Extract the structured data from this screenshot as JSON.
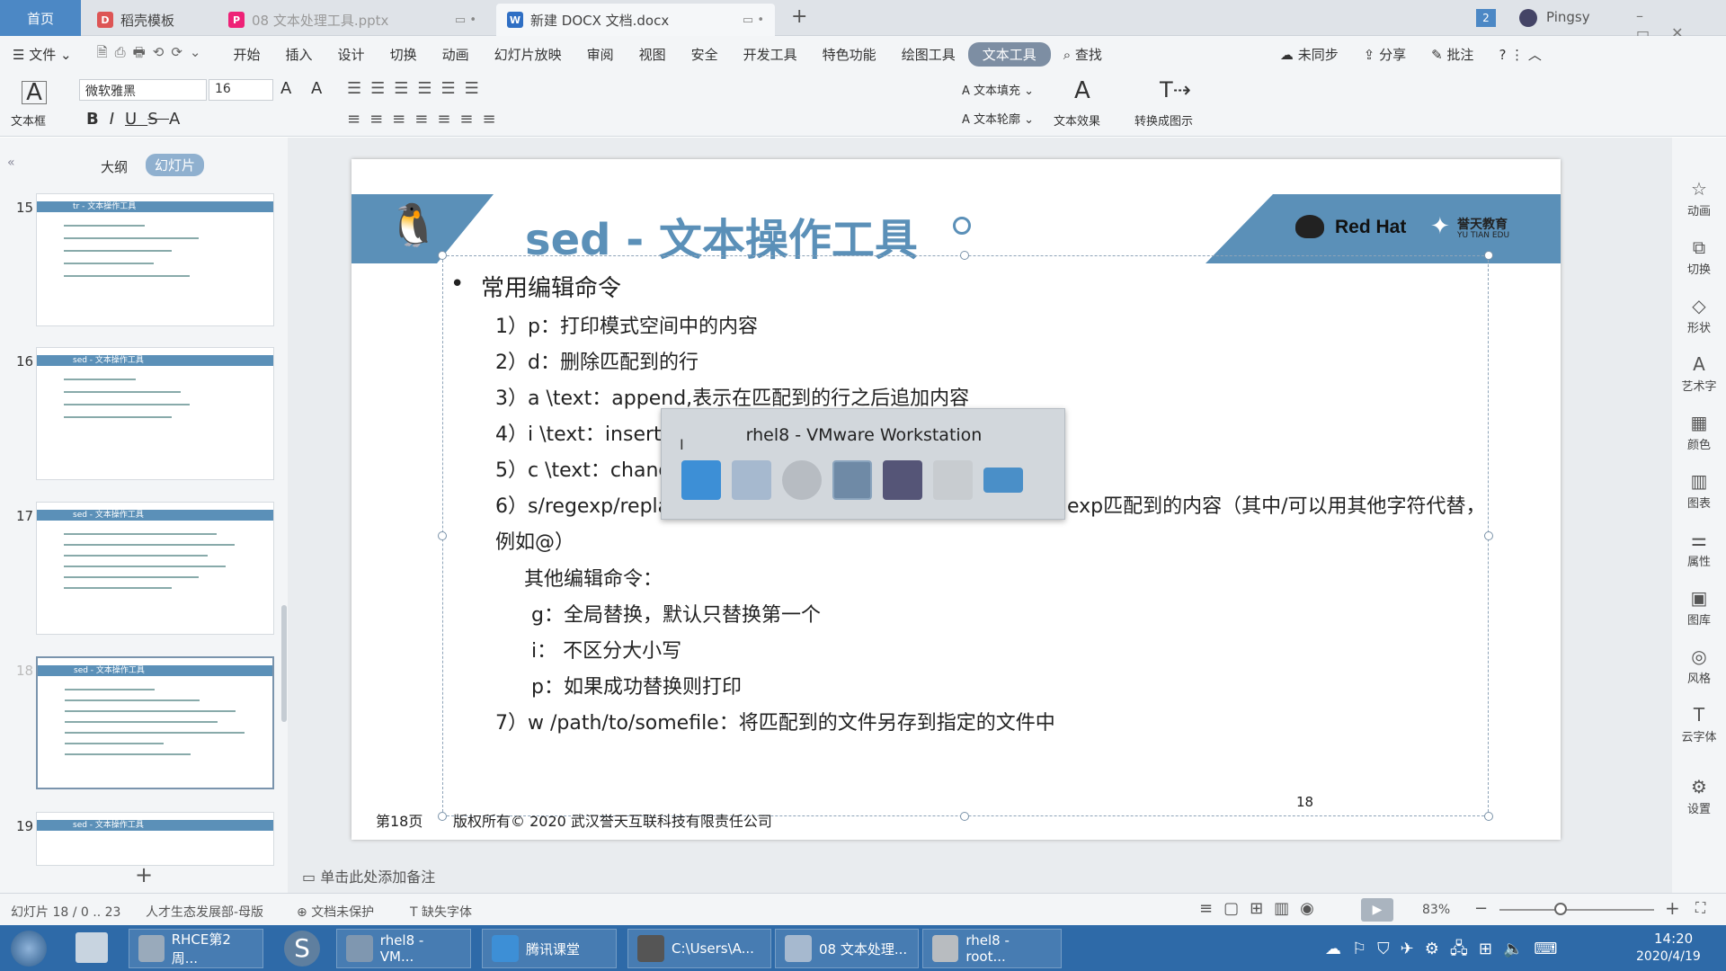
{
  "tabs": [
    {
      "label": "首页"
    },
    {
      "label": "稻壳模板"
    },
    {
      "label": "08 文本处理工具.pptx"
    },
    {
      "label": "新建 DOCX 文档.docx"
    }
  ],
  "window": {
    "badge": "2",
    "user": "Pingsy"
  },
  "menu": {
    "file": "文件",
    "items": [
      "开始",
      "插入",
      "设计",
      "切换",
      "动画",
      "幻灯片放映",
      "审阅",
      "视图",
      "安全",
      "开发工具",
      "特色功能",
      "绘图工具",
      "文本工具"
    ],
    "search": "查找",
    "sync": "未同步",
    "share": "分享",
    "review": "批注"
  },
  "ribbon": {
    "textbox": "文本框",
    "font": "微软雅黑",
    "size": "16",
    "fill": "文本填充",
    "outline": "文本轮廓",
    "effect": "文本效果",
    "convert": "转换成图示"
  },
  "left": {
    "outline_tab": "大纲",
    "slides_tab": "幻灯片",
    "thumbs": [
      {
        "num": "15",
        "title": "tr - 文本操作工具"
      },
      {
        "num": "16",
        "title": "sed - 文本操作工具"
      },
      {
        "num": "17",
        "title": "sed - 文本操作工具"
      },
      {
        "num": "18",
        "title": "sed - 文本操作工具"
      },
      {
        "num": "19",
        "title": "sed - 文本操作工具"
      }
    ],
    "notes": "单击此处添加备注"
  },
  "slide": {
    "title": "sed - 文本操作工具",
    "brand1": "Red Hat",
    "brand2": "誉天教育",
    "brand3": "YU TIAN EDU",
    "heading": "常用编辑命令",
    "lines": [
      "1）p：打印模式空间中的内容",
      "2）d：删除匹配到的行",
      "3）a \\text：append,表示在匹配到的行之后追加内容",
      "4）i \\text：insert,",
      "5）c \\text：chang",
      "6）s/regexp/repla",
      "exp匹配到的内容（其中/可以用其他字符代替，",
      "例如@）",
      "其他编辑命令：",
      "g：全局替换，默认只替换第一个",
      "i： 不区分大小写",
      "p：如果成功替换则打印",
      "7）w /path/to/somefile：将匹配到的文件另存到指定的文件中"
    ],
    "footer_page": "第18页",
    "footer_copy": "版权所有© 2020 武汉誉天互联科技有限责任公司",
    "page_number": "18"
  },
  "popup": {
    "title": "rhel8 - VMware Workstation"
  },
  "right": [
    "动画",
    "切换",
    "形状",
    "艺术字",
    "颜色",
    "图表",
    "属性",
    "图库",
    "风格",
    "云字体",
    "设置"
  ],
  "status": {
    "slide": "幻灯片 18 / 0 .. 23",
    "template": "人才生态发展部-母版",
    "protect": "文档未保护",
    "font": "缺失字体",
    "zoom": "83%"
  },
  "taskbar": {
    "items": [
      "RHCE第2周...",
      "rhel8 - VM...",
      "腾讯课堂",
      "C:\\Users\\A...",
      "08 文本处理...",
      "rhel8 - root..."
    ],
    "time": "14:20",
    "date": "2020/4/19"
  }
}
